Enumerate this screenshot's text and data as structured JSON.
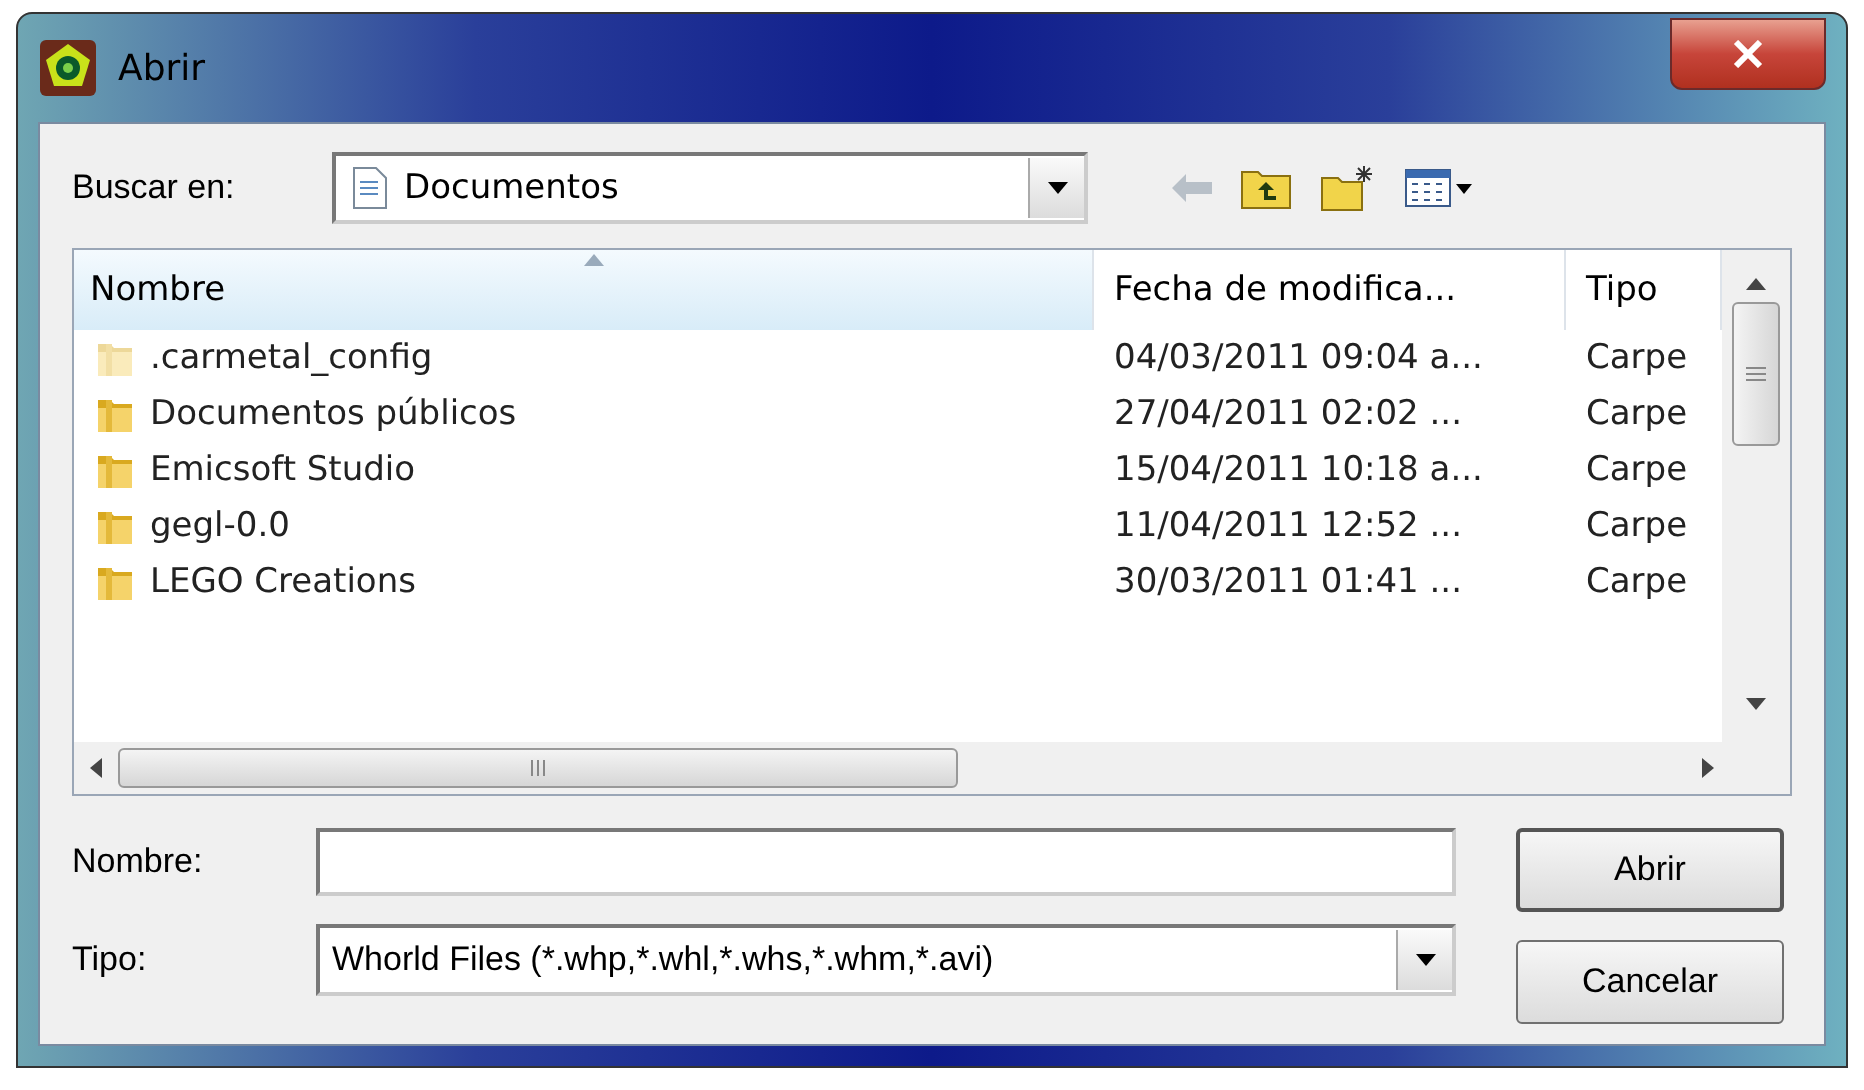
{
  "window": {
    "title": "Abrir"
  },
  "look_in": {
    "label": "Buscar en:",
    "value": "Documentos"
  },
  "table": {
    "columns": [
      {
        "label": "Nombre",
        "sorted": true
      },
      {
        "label": "Fecha de modifica...",
        "sorted": false
      },
      {
        "label": "Tipo",
        "sorted": false
      }
    ],
    "rows": [
      {
        "name": ".carmetal_config",
        "date": "04/03/2011 09:04 a...",
        "type": "Carpe",
        "hidden": true
      },
      {
        "name": "Documentos públicos",
        "date": "27/04/2011 02:02 ...",
        "type": "Carpe",
        "hidden": false
      },
      {
        "name": "Emicsoft Studio",
        "date": "15/04/2011 10:18 a...",
        "type": "Carpe",
        "hidden": false
      },
      {
        "name": "gegl-0.0",
        "date": "11/04/2011 12:52 ...",
        "type": "Carpe",
        "hidden": false
      },
      {
        "name": "LEGO Creations",
        "date": "30/03/2011 01:41 ...",
        "type": "Carpe",
        "hidden": false
      }
    ]
  },
  "file_name": {
    "label": "Nombre:"
  },
  "file_type": {
    "label": "Tipo:",
    "value": "Whorld Files (*.whp,*.whl,*.whs,*.whm,*.avi)"
  },
  "buttons": [
    {
      "label": "Abrir"
    },
    {
      "label": "Cancelar"
    }
  ]
}
